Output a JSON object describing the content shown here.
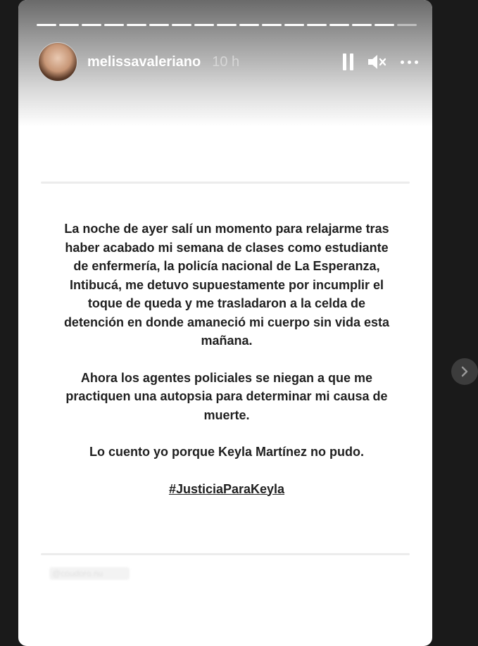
{
  "story": {
    "progress_segments": 17,
    "header": {
      "username": "melissavaleriano",
      "time": "10 h"
    },
    "message": {
      "paragraphs": [
        "La noche de ayer salí un momento para relajarme tras haber acabado mi semana de clases como estudiante de enfermería, la policía nacional de La Esperanza, Intibucá, me detuvo supuestamente por incumplir el toque de queda y me trasladaron a la celda de detención en donde amaneció mi cuerpo sin vida esta mañana.",
        "Ahora los agentes policiales se niegan a que me practiquen una autopsia para determinar mi causa de muerte.",
        "Lo cuento yo porque Keyla Martínez no pudo."
      ],
      "hashtag": "#JusticiaParaKeyla"
    },
    "watermark": "@coudoro.nu"
  },
  "icons": {
    "pause": "pause-icon",
    "mute": "speaker-muted-icon",
    "more": "more-dots-icon",
    "next": "chevron-right-icon"
  },
  "colors": {
    "background": "#1a1a1a",
    "story_bg": "#ffffff",
    "text": "#1f1f1f"
  }
}
